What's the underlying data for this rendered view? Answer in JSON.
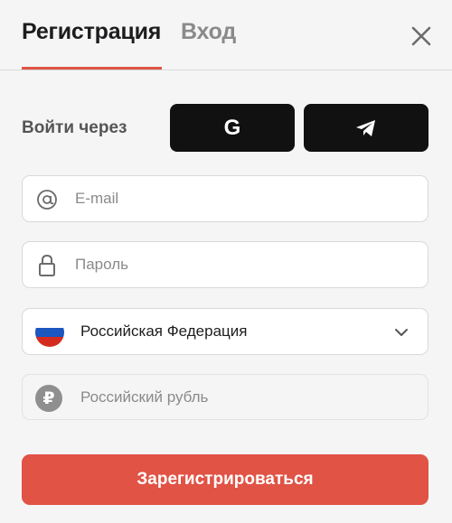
{
  "header": {
    "tab_register": "Регистрация",
    "tab_login": "Вход",
    "close_icon": "close-icon"
  },
  "social": {
    "label": "Войти через",
    "google_letter": "G",
    "google_icon": "google-icon",
    "telegram_icon": "telegram-icon"
  },
  "form": {
    "email_placeholder": "E-mail",
    "email_value": "",
    "password_placeholder": "Пароль",
    "password_value": "",
    "country_selected": "Российская Федерация",
    "currency": "Российский рубль",
    "currency_symbol": "₽",
    "submit_label": "Зарегистрироваться"
  },
  "colors": {
    "accent": "#e05345",
    "social_button_bg": "#111111",
    "page_bg": "#f5f5f5"
  }
}
